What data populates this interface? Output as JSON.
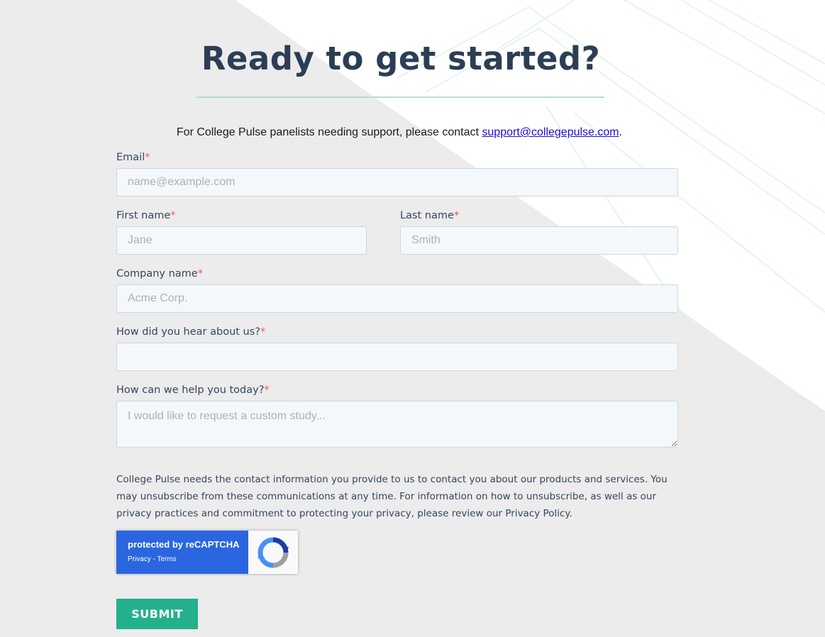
{
  "page": {
    "headline": "Ready to get started?",
    "support_text": "For College Pulse panelists needing support, please contact ",
    "support_email": "support@collegepulse.com",
    "support_suffix": "."
  },
  "form": {
    "required_marker": "*",
    "email": {
      "label": "Email",
      "placeholder": "name@example.com",
      "value": ""
    },
    "first_name": {
      "label": "First name",
      "placeholder": "Jane",
      "value": ""
    },
    "last_name": {
      "label": "Last name",
      "placeholder": "Smith",
      "value": ""
    },
    "company": {
      "label": "Company name",
      "placeholder": "Acme Corp.",
      "value": ""
    },
    "hear_about": {
      "label": "How did you hear about us?",
      "placeholder": "",
      "value": ""
    },
    "help_today": {
      "label": "How can we help you today?",
      "placeholder": "I would like to request a custom study...",
      "value": ""
    },
    "legal_text": "College Pulse needs the contact information you provide to us to contact you about our products and services. You may unsubscribe from these communications at any time. For information on how to unsubscribe, as well as our privacy practices and commitment to protecting your privacy, please review our Privacy Policy.",
    "recaptcha": {
      "title": "protected by reCAPTCHA",
      "links": "Privacy - Terms",
      "logo_icon": "recaptcha-logo-icon",
      "color": "#2a66e0"
    },
    "submit_label": "SUBMIT"
  },
  "colors": {
    "headline": "#2c3e55",
    "accent": "#23b08d",
    "required": "#f2545b",
    "link": "#1a0dcc"
  }
}
